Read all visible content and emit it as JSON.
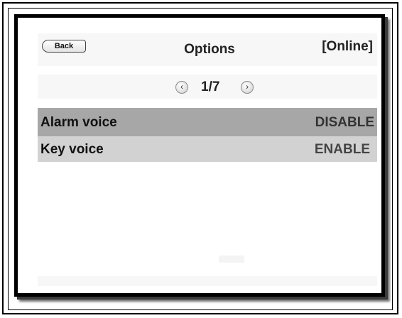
{
  "header": {
    "back_label": "Back",
    "title": "Options",
    "status": "[Online]"
  },
  "pager": {
    "prev_icon": "chevron-left-icon",
    "next_icon": "chevron-right-icon",
    "indicator": "1/7"
  },
  "options": [
    {
      "label": "Alarm voice",
      "value": "DISABLE",
      "selected": true
    },
    {
      "label": "Key voice",
      "value": "ENABLE",
      "selected": false
    }
  ],
  "colors": {
    "selected_row": "#a7a7a7",
    "normal_row": "#d2d2d2",
    "frame": "#000000"
  }
}
